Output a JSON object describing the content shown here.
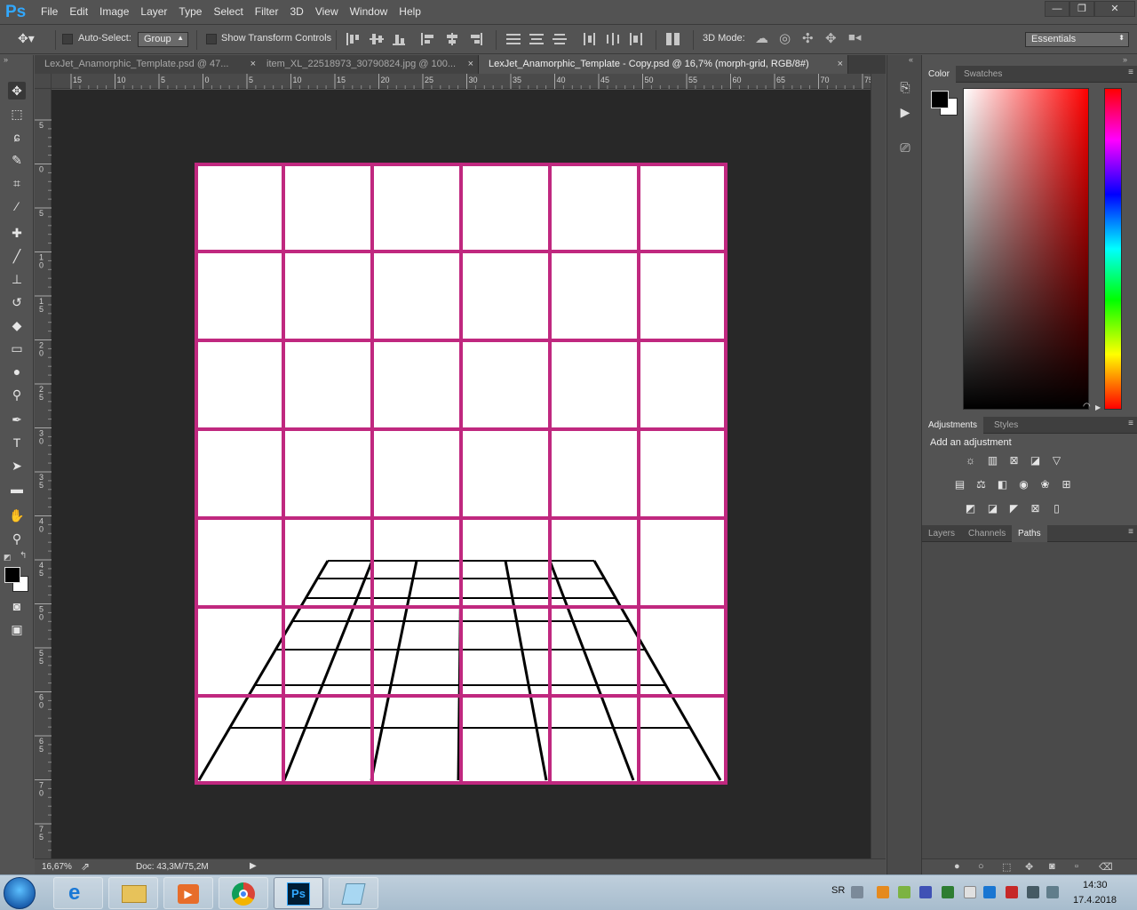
{
  "app": {
    "logo": "Ps"
  },
  "menu": [
    "File",
    "Edit",
    "Image",
    "Layer",
    "Type",
    "Select",
    "Filter",
    "3D",
    "View",
    "Window",
    "Help"
  ],
  "window_controls": {
    "minimize": "—",
    "restore": "❐",
    "close": "✕"
  },
  "options": {
    "auto_select_label": "Auto-Select:",
    "auto_select_value": "Group",
    "show_transform_label": "Show Transform Controls",
    "mode_3d_label": "3D Mode:",
    "workspace": "Essentials"
  },
  "tabs": [
    {
      "label": "LexJet_Anamorphic_Template.psd @ 47...",
      "close": "×",
      "active": false
    },
    {
      "label": "item_XL_22518973_30790824.jpg @ 100...",
      "close": "×",
      "active": false
    },
    {
      "label": "LexJet_Anamorphic_Template - Copy.psd @ 16,7% (morph-grid, RGB/8#)",
      "close": "×",
      "active": true
    }
  ],
  "ruler_top_labels": [
    "15",
    "10",
    "5",
    "0",
    "5",
    "10",
    "15",
    "20",
    "25",
    "30",
    "35",
    "40",
    "45",
    "50",
    "55",
    "60",
    "65",
    "70",
    "75"
  ],
  "ruler_left_labels": [
    "5",
    "0",
    "5",
    "1\n0",
    "1\n5",
    "2\n0",
    "2\n5",
    "3\n0",
    "3\n5",
    "4\n0",
    "4\n5",
    "5\n0",
    "5\n5",
    "6\n0",
    "6\n5",
    "7\n0",
    "7\n5"
  ],
  "status": {
    "zoom": "16,67%",
    "doc": "Doc: 43,3M/75,2M"
  },
  "panels": {
    "color_tabs": [
      "Color",
      "Swatches"
    ],
    "adjust_tabs": [
      "Adjustments",
      "Styles"
    ],
    "adjust_title": "Add an adjustment",
    "layer_tabs": [
      "Layers",
      "Channels",
      "Paths"
    ],
    "active_layer_tab": "Paths"
  },
  "colors": {
    "grid_magenta": "#c0287f",
    "perspective_black": "#000000"
  },
  "taskbar": {
    "lang": "SR",
    "time": "14:30",
    "date": "17.4.2018",
    "ps_label": "Ps"
  }
}
